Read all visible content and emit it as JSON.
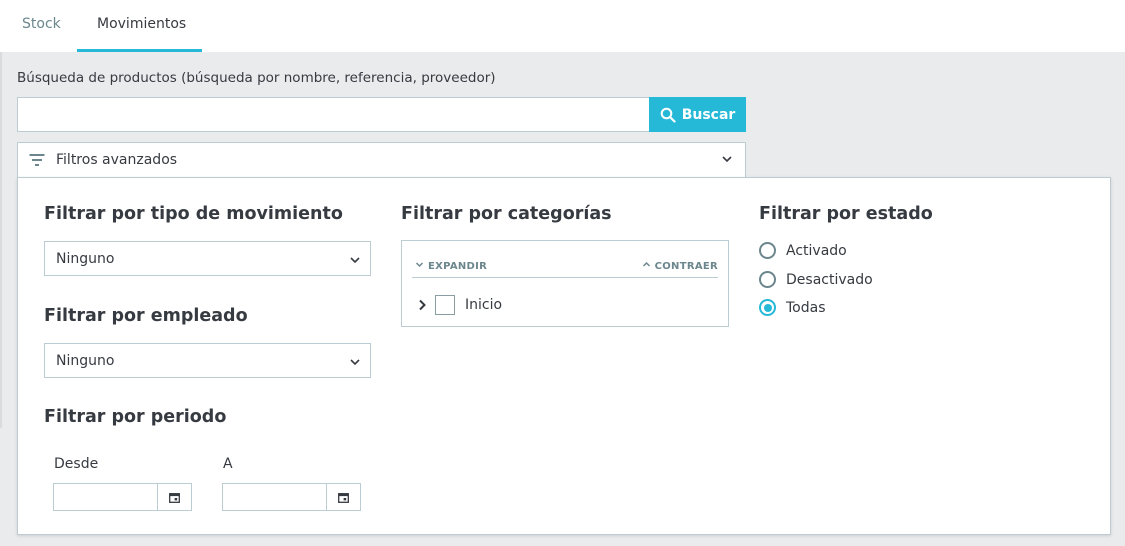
{
  "tabs": [
    {
      "label": "Stock"
    },
    {
      "label": "Movimientos",
      "active": true
    }
  ],
  "search": {
    "label": "Búsqueda de productos (búsqueda por nombre, referencia, proveedor)",
    "value": "",
    "placeholder": "",
    "button_label": "Buscar",
    "button_icon": "search-icon"
  },
  "advanced": {
    "toggle_label": "Filtros avanzados",
    "toggle_icon": "filter-icon",
    "movement_type": {
      "heading": "Filtrar por tipo de movimiento",
      "selected": "Ninguno"
    },
    "employee": {
      "heading": "Filtrar por empleado",
      "selected": "Ninguno"
    },
    "period": {
      "heading": "Filtrar por periodo",
      "from_label": "Desde",
      "to_label": "A",
      "from_value": "",
      "to_value": ""
    },
    "categories": {
      "heading": "Filtrar por categorías",
      "expand_label": "EXPANDIR",
      "collapse_label": "CONTRAER",
      "tree": [
        {
          "label": "Inicio",
          "checked": false
        }
      ]
    },
    "status": {
      "heading": "Filtrar por estado",
      "options": [
        {
          "label": "Activado",
          "selected": false
        },
        {
          "label": "Desactivado",
          "selected": false
        },
        {
          "label": "Todas",
          "selected": true
        }
      ]
    }
  },
  "colors": {
    "accent": "#25b9d7",
    "text": "#363a41",
    "muted": "#6c868e",
    "border": "#bbcdd2",
    "background": "#eaebec"
  }
}
